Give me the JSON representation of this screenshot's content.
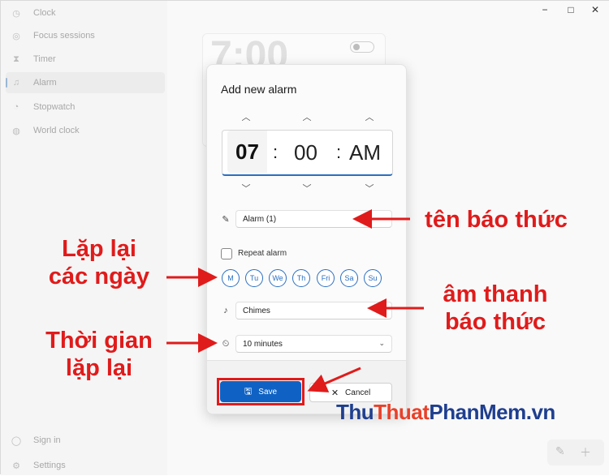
{
  "sidebar": {
    "items": [
      {
        "label": "Clock",
        "icon": "clock-icon",
        "glyph": "◷"
      },
      {
        "label": "Focus sessions",
        "icon": "focus-icon",
        "glyph": "◎"
      },
      {
        "label": "Timer",
        "icon": "hourglass-icon",
        "glyph": "⧗"
      },
      {
        "label": "Alarm",
        "icon": "bell-icon",
        "glyph": "♫"
      },
      {
        "label": "Stopwatch",
        "icon": "stopwatch-icon",
        "glyph": "◔"
      },
      {
        "label": "World clock",
        "icon": "globe-icon",
        "glyph": "◍"
      }
    ],
    "bottom": [
      {
        "label": "Sign in",
        "icon": "person-icon",
        "glyph": "◯"
      },
      {
        "label": "Settings",
        "icon": "gear-icon",
        "glyph": "⚙"
      }
    ]
  },
  "window_controls": {
    "minimize": "−",
    "maximize": "□",
    "close": "✕"
  },
  "background_alarm": {
    "time": "7:00"
  },
  "dialog": {
    "title": "Add new alarm",
    "hour": "07",
    "separator": ":",
    "minute": "00",
    "period": "AM",
    "alarm_name": "Alarm (1)",
    "repeat_label": "Repeat alarm",
    "repeat_checked": false,
    "days": [
      "M",
      "Tu",
      "We",
      "Th",
      "Fri",
      "Sa",
      "Su"
    ],
    "sound": "Chimes",
    "snooze": "10 minutes",
    "save_label": "Save",
    "cancel_label": "Cancel"
  },
  "annotations": {
    "alarm_name": "tên báo thức",
    "repeat_days_line1": "Lặp lại",
    "repeat_days_line2": "các ngày",
    "sound_line1": "âm thanh",
    "sound_line2": "báo thức",
    "snooze_line1": "Thời gian",
    "snooze_line2": "lặp lại"
  },
  "watermark": {
    "part1": "Thu",
    "part2": "Thuat",
    "part3": "PhanMem.vn"
  },
  "colors": {
    "accent": "#0f62c4",
    "annotation": "#e01b1b",
    "watermark_blue": "#1f3f8f",
    "watermark_red": "#e8412a"
  }
}
